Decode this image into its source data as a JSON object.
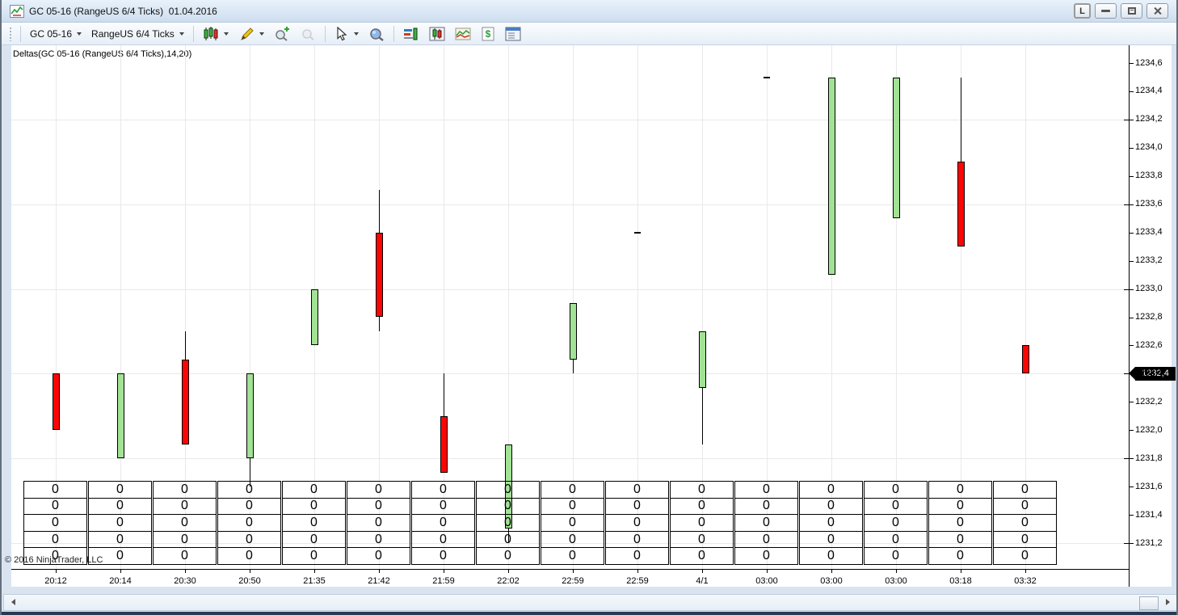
{
  "window": {
    "title": "GC 05-16 (RangeUS 6/4 Ticks)  01.04.2016",
    "controls": {
      "link_label": "L",
      "buttons": [
        "link",
        "minimize",
        "restore",
        "close"
      ]
    }
  },
  "toolbar": {
    "instrument": "GC 05-16",
    "period": "RangeUS 6/4 Ticks",
    "icons": [
      "chart-style-icon",
      "drawing-tools-icon",
      "zoom-in-icon",
      "zoom-out-icon",
      "cursor-icon",
      "data-box-icon",
      "chart-trader-icon",
      "indicators-icon",
      "chart-panel-icon",
      "account-dollar-icon",
      "properties-icon"
    ]
  },
  "chart": {
    "indicator_label": "Deltas(GC 05-16 (RangeUS 6/4 Ticks),14,20)",
    "copyright": "© 2016 NinjaTrader, LLC"
  },
  "chart_data": {
    "type": "candlestick",
    "title": "GC 05-16 (RangeUS 6/4 Ticks) 01.04.2016",
    "x_labels": [
      "20:12",
      "20:14",
      "20:30",
      "20:50",
      "21:35",
      "21:42",
      "21:59",
      "22:02",
      "22:59",
      "22:59",
      "4/1",
      "03:00",
      "03:00",
      "03:00",
      "03:18",
      "03:32"
    ],
    "candles": [
      {
        "time": "20:12",
        "open": 1232.4,
        "high": 1232.4,
        "low": 1232.0,
        "close": 1232.0
      },
      {
        "time": "20:14",
        "open": 1231.8,
        "high": 1232.4,
        "low": 1231.8,
        "close": 1232.4
      },
      {
        "time": "20:30",
        "open": 1232.5,
        "high": 1232.7,
        "low": 1231.9,
        "close": 1231.9
      },
      {
        "time": "20:50",
        "open": 1231.8,
        "high": 1232.4,
        "low": 1231.6,
        "close": 1232.4
      },
      {
        "time": "21:35",
        "open": 1232.6,
        "high": 1233.0,
        "low": 1232.6,
        "close": 1233.0
      },
      {
        "time": "21:42",
        "open": 1233.4,
        "high": 1233.7,
        "low": 1232.7,
        "close": 1232.8
      },
      {
        "time": "21:59",
        "open": 1232.1,
        "high": 1232.4,
        "low": 1231.7,
        "close": 1231.7
      },
      {
        "time": "22:02",
        "open": 1231.3,
        "high": 1231.9,
        "low": 1231.2,
        "close": 1231.9
      },
      {
        "time": "22:59",
        "open": 1232.5,
        "high": 1232.9,
        "low": 1232.4,
        "close": 1232.9
      },
      {
        "time": "22:59",
        "open": 1233.4,
        "high": 1233.4,
        "low": 1233.4,
        "close": 1233.4
      },
      {
        "time": "4/1",
        "open": 1232.3,
        "high": 1232.7,
        "low": 1231.9,
        "close": 1232.7
      },
      {
        "time": "03:00",
        "open": 1234.5,
        "high": 1234.5,
        "low": 1234.5,
        "close": 1234.5
      },
      {
        "time": "03:00",
        "open": 1233.1,
        "high": 1234.5,
        "low": 1233.1,
        "close": 1234.5
      },
      {
        "time": "03:00",
        "open": 1233.5,
        "high": 1234.5,
        "low": 1233.5,
        "close": 1234.5
      },
      {
        "time": "03:18",
        "open": 1233.9,
        "high": 1234.5,
        "low": 1233.3,
        "close": 1233.3
      },
      {
        "time": "03:32",
        "open": 1232.6,
        "high": 1232.6,
        "low": 1232.4,
        "close": 1232.4
      }
    ],
    "y_axis": {
      "min": 1231.2,
      "max": 1234.6,
      "tick_step": 0.2,
      "values": [
        1234.6,
        1234.4,
        1234.2,
        1234.0,
        1233.8,
        1233.6,
        1233.4,
        1233.2,
        1233.0,
        1232.8,
        1232.6,
        1232.4,
        1232.2,
        1232.0,
        1231.8,
        1231.6,
        1231.4,
        1231.2
      ],
      "labels": [
        "1234,6",
        "1234,4",
        "1234,2",
        "1234,0",
        "1233,8",
        "1233,6",
        "1233,4",
        "1233,2",
        "1233,0",
        "1232,8",
        "1232,6",
        "1232,4",
        "1232,2",
        "1232,0",
        "1231,8",
        "1231,6",
        "1231,4",
        "1231,2"
      ]
    },
    "gridline_prices": [
      1234.2,
      1233.6,
      1233.0,
      1232.4,
      1231.8,
      1231.2
    ],
    "current_price": 1232.4,
    "current_price_label": "1232,4",
    "grid": true,
    "legend_position": "none",
    "colors": {
      "up": "#a2e295",
      "down": "#fb0505",
      "wick": "#000000",
      "grid": "#e9e9e9",
      "price_marker_bg": "#000000",
      "price_marker_text": "#ffffff"
    }
  },
  "stats_table": {
    "rows": 5,
    "columns": 16,
    "cell_values": [
      [
        "0",
        "0",
        "0",
        "0",
        "0",
        "0",
        "0",
        "0",
        "0",
        "0",
        "0",
        "0",
        "0",
        "0",
        "0",
        "0"
      ],
      [
        "0",
        "0",
        "0",
        "0",
        "0",
        "0",
        "0",
        "0",
        "0",
        "0",
        "0",
        "0",
        "0",
        "0",
        "0",
        "0"
      ],
      [
        "0",
        "0",
        "0",
        "0",
        "0",
        "0",
        "0",
        "0",
        "0",
        "0",
        "0",
        "0",
        "0",
        "0",
        "0",
        "0"
      ],
      [
        "0",
        "0",
        "0",
        "0",
        "0",
        "0",
        "0",
        "0",
        "0",
        "0",
        "0",
        "0",
        "0",
        "0",
        "0",
        "0"
      ],
      [
        "0",
        "0",
        "0",
        "0",
        "0",
        "0",
        "0",
        "0",
        "0",
        "0",
        "0",
        "0",
        "0",
        "0",
        "0",
        "0"
      ]
    ]
  },
  "scrollbar": {
    "left_arrow": "left-arrow-icon",
    "right_arrow": "right-arrow-icon"
  }
}
